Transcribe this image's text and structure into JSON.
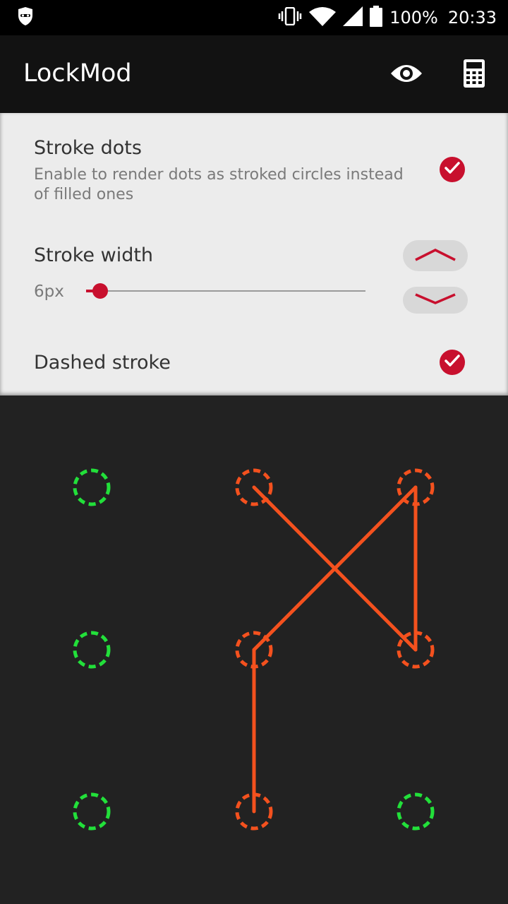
{
  "status_bar": {
    "battery": "100%",
    "time": "20:33",
    "icons": [
      "incognito-icon",
      "vibrate-icon",
      "wifi-icon",
      "signal-icon",
      "battery-icon"
    ]
  },
  "toolbar": {
    "title": "LockMod",
    "actions": [
      "eye-icon",
      "calculator-icon"
    ]
  },
  "settings": {
    "stroke_dots": {
      "title": "Stroke dots",
      "subtitle": "Enable to render dots as stroked circles instead of filled ones",
      "checked": true
    },
    "stroke_width": {
      "title": "Stroke width",
      "value_label": "6px",
      "slider_fraction": 0.05
    },
    "dashed_stroke": {
      "title": "Dashed stroke",
      "checked": true
    }
  },
  "pattern": {
    "grid_size": 3,
    "colors": {
      "inactive": "#22e03a",
      "active": "#f4511e",
      "line": "#f4511e",
      "background": "#222222"
    },
    "dots_active": [
      false,
      true,
      true,
      false,
      true,
      true,
      false,
      true,
      false
    ],
    "path": [
      1,
      5,
      2,
      4,
      7
    ]
  },
  "colors": {
    "accent": "#c8102e",
    "toolbar": "#121212",
    "panel": "#ececec"
  }
}
